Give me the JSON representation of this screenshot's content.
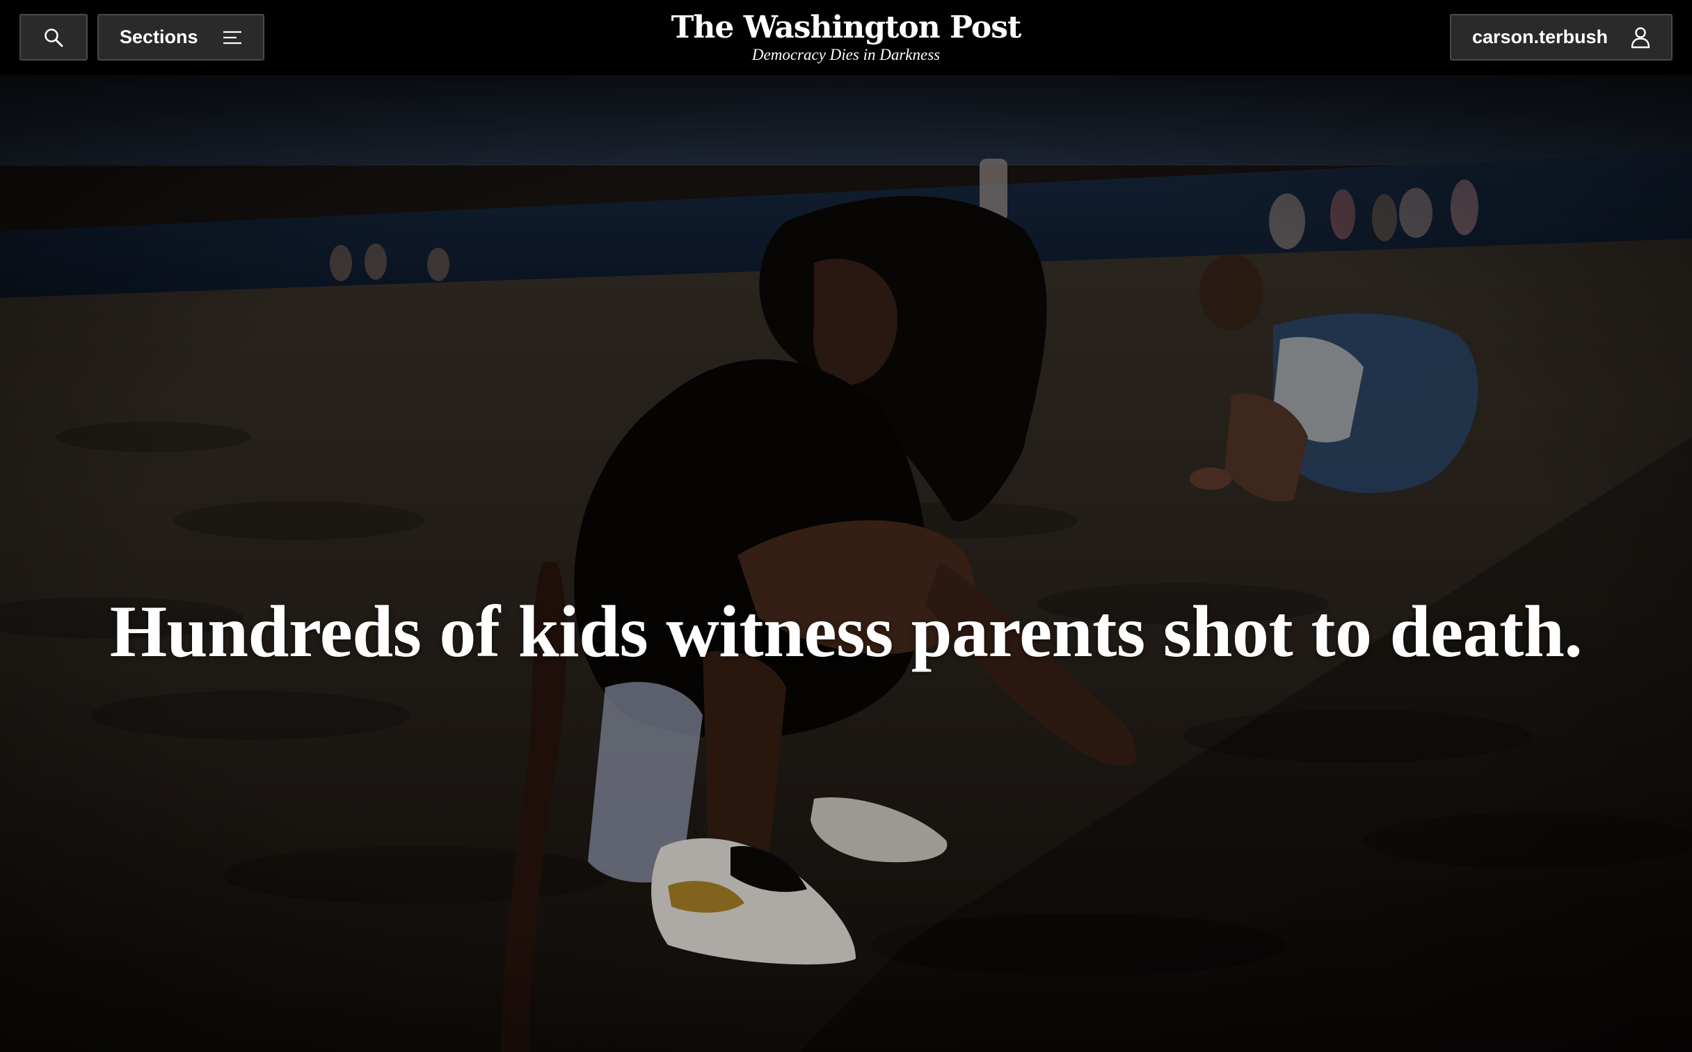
{
  "header": {
    "search_icon": "search-icon",
    "sections_label": "Sections",
    "sections_icon": "menu-lines-icon",
    "logo_text": "The Washington Post",
    "tagline": "Democracy Dies in Darkness",
    "account_label": "carson.terbush",
    "account_icon": "user-icon"
  },
  "hero": {
    "headline": "Hundreds of kids witness parents shot to death.",
    "photo_description_icon": "beach-photo"
  },
  "colors": {
    "background": "#000000",
    "button_bg": "#2a2a2a",
    "button_border": "#4a4a4a",
    "text": "#ffffff"
  }
}
